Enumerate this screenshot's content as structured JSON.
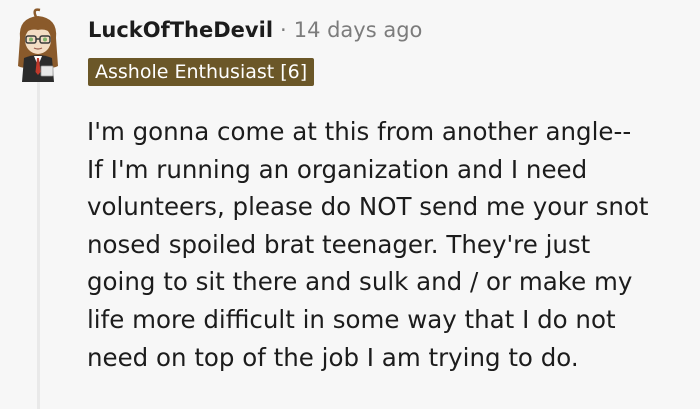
{
  "comment": {
    "author": "LuckOfTheDevil",
    "separator": "·",
    "timestamp": "14 days ago",
    "flair": "Asshole Enthusiast [6]",
    "body_lines": [
      "I'm gonna come at this from another angle--",
      "If I'm running an organization and I need",
      "volunteers, please do NOT send me your snot",
      "nosed spoiled brat teenager. They're just",
      "going to sit there and sulk and / or make my",
      "life more difficult in some way that I do not",
      "need on top of the job I am trying to do."
    ],
    "avatar": {
      "icon": "user-avatar-icon",
      "hair_color": "#8a5a2b",
      "skin_color": "#f3ddc4",
      "eye_color": "#7fb36a",
      "jacket_color": "#2b2b2b",
      "tie_color": "#c0392b"
    }
  },
  "colors": {
    "background": "#f7f7f7",
    "text": "#1c1c1c",
    "meta": "#7c7c7c",
    "flair_bg": "#6b5728",
    "flair_text": "#ffffff",
    "thread_line": "#e9e9e9"
  }
}
